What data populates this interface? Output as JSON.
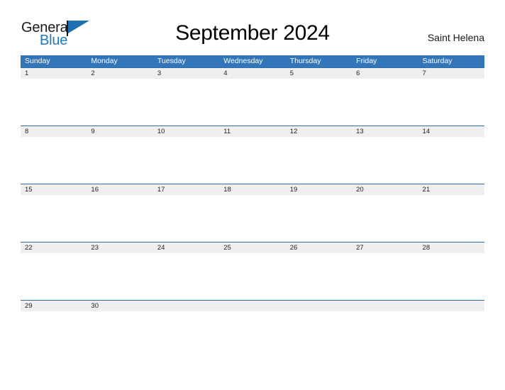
{
  "brand": {
    "name_part1": "General",
    "name_part2": "Blue",
    "accent_color": "#1f7ac0",
    "flag_icon": "flag-triangle-icon"
  },
  "header": {
    "title": "September 2024",
    "location": "Saint Helena"
  },
  "calendar": {
    "header_bg": "#3275b8",
    "day_band_bg": "#efefef",
    "weekdays": [
      "Sunday",
      "Monday",
      "Tuesday",
      "Wednesday",
      "Thursday",
      "Friday",
      "Saturday"
    ],
    "weeks": [
      {
        "days": [
          "1",
          "2",
          "3",
          "4",
          "5",
          "6",
          "7"
        ]
      },
      {
        "days": [
          "8",
          "9",
          "10",
          "11",
          "12",
          "13",
          "14"
        ]
      },
      {
        "days": [
          "15",
          "16",
          "17",
          "18",
          "19",
          "20",
          "21"
        ]
      },
      {
        "days": [
          "22",
          "23",
          "24",
          "25",
          "26",
          "27",
          "28"
        ]
      },
      {
        "days": [
          "29",
          "30",
          "",
          "",
          "",
          "",
          ""
        ]
      }
    ]
  }
}
